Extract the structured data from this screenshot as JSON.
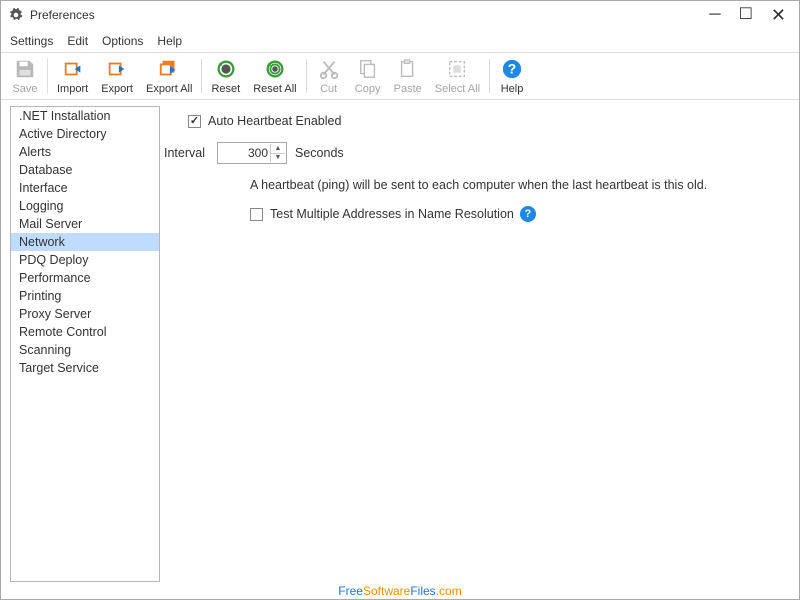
{
  "window": {
    "title": "Preferences"
  },
  "menu": {
    "settings": "Settings",
    "edit": "Edit",
    "options": "Options",
    "help": "Help"
  },
  "toolbar": {
    "save": "Save",
    "import": "Import",
    "export": "Export",
    "exportAll": "Export All",
    "reset": "Reset",
    "resetAll": "Reset All",
    "cut": "Cut",
    "copy": "Copy",
    "paste": "Paste",
    "selectAll": "Select All",
    "help": "Help"
  },
  "sidebar": {
    "items": [
      ".NET Installation",
      "Active Directory",
      "Alerts",
      "Database",
      "Interface",
      "Logging",
      "Mail Server",
      "Network",
      "PDQ Deploy",
      "Performance",
      "Printing",
      "Proxy Server",
      "Remote Control",
      "Scanning",
      "Target Service"
    ],
    "selectedIndex": 7
  },
  "main": {
    "autoHeartbeat": {
      "label": "Auto Heartbeat Enabled",
      "checked": true
    },
    "intervalLabel": "Interval",
    "intervalValue": "300",
    "intervalUnit": "Seconds",
    "hint": "A heartbeat (ping) will be sent to each computer when the last heartbeat is this old.",
    "testMultiple": {
      "label": "Test Multiple Addresses in Name Resolution",
      "checked": false
    }
  },
  "watermark": {
    "a": "Free",
    "b": "Software",
    "c": "Files",
    "d": ".com"
  }
}
